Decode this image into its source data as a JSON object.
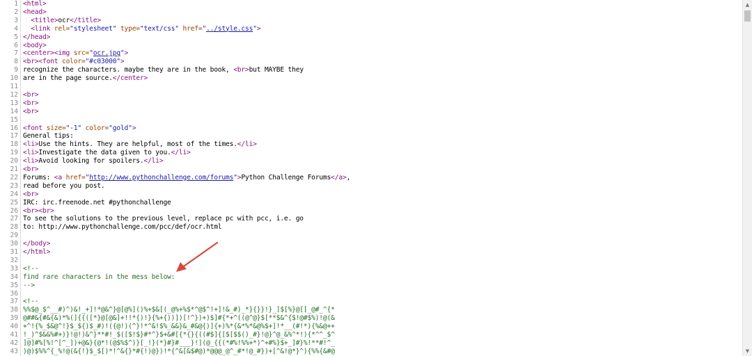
{
  "source_view": {
    "lines": [
      {
        "n": "1",
        "segs": [
          {
            "t": "<html>",
            "c": "tag"
          }
        ]
      },
      {
        "n": "2",
        "segs": [
          {
            "t": "<head>",
            "c": "tag"
          }
        ]
      },
      {
        "n": "3",
        "segs": [
          {
            "t": "  <title>",
            "c": "tag"
          },
          {
            "t": "ocr",
            "c": "text"
          },
          {
            "t": "</title>",
            "c": "tag"
          }
        ]
      },
      {
        "n": "4",
        "segs": [
          {
            "t": "  <link ",
            "c": "tag"
          },
          {
            "t": "rel=",
            "c": "attr"
          },
          {
            "t": "\"stylesheet\" ",
            "c": "val"
          },
          {
            "t": "type=",
            "c": "attr"
          },
          {
            "t": "\"text/css\" ",
            "c": "val"
          },
          {
            "t": "href=",
            "c": "attr"
          },
          {
            "t": "\"",
            "c": "val"
          },
          {
            "t": "../style.css",
            "c": "link"
          },
          {
            "t": "\"",
            "c": "val"
          },
          {
            "t": ">",
            "c": "tag"
          }
        ]
      },
      {
        "n": "5",
        "segs": [
          {
            "t": "</head>",
            "c": "tag"
          }
        ]
      },
      {
        "n": "6",
        "segs": [
          {
            "t": "<body>",
            "c": "tag"
          }
        ]
      },
      {
        "n": "7",
        "segs": [
          {
            "t": "<center><img ",
            "c": "tag"
          },
          {
            "t": "src=",
            "c": "attr"
          },
          {
            "t": "\"",
            "c": "val"
          },
          {
            "t": "ocr.jpg",
            "c": "link"
          },
          {
            "t": "\"",
            "c": "val"
          },
          {
            "t": ">",
            "c": "tag"
          }
        ]
      },
      {
        "n": "8",
        "segs": [
          {
            "t": "<br><font ",
            "c": "tag"
          },
          {
            "t": "color=",
            "c": "attr"
          },
          {
            "t": "\"#c03000\"",
            "c": "val"
          },
          {
            "t": ">",
            "c": "tag"
          }
        ]
      },
      {
        "n": "9",
        "segs": [
          {
            "t": "recognize the characters. maybe they are in the book, ",
            "c": "text"
          },
          {
            "t": "<br>",
            "c": "tag"
          },
          {
            "t": "but MAYBE they",
            "c": "text"
          }
        ]
      },
      {
        "n": "10",
        "segs": [
          {
            "t": "are in the page source.",
            "c": "text"
          },
          {
            "t": "</center>",
            "c": "tag"
          }
        ]
      },
      {
        "n": "11",
        "segs": []
      },
      {
        "n": "12",
        "segs": [
          {
            "t": "<br>",
            "c": "tag"
          }
        ]
      },
      {
        "n": "13",
        "segs": [
          {
            "t": "<br>",
            "c": "tag"
          }
        ]
      },
      {
        "n": "14",
        "segs": [
          {
            "t": "<br>",
            "c": "tag"
          }
        ]
      },
      {
        "n": "15",
        "segs": []
      },
      {
        "n": "16",
        "segs": [
          {
            "t": "<font ",
            "c": "tag"
          },
          {
            "t": "size=",
            "c": "attr"
          },
          {
            "t": "\"-1\" ",
            "c": "val"
          },
          {
            "t": "color=",
            "c": "attr"
          },
          {
            "t": "\"gold\"",
            "c": "val"
          },
          {
            "t": ">",
            "c": "tag"
          }
        ]
      },
      {
        "n": "17",
        "segs": [
          {
            "t": "General tips:",
            "c": "text"
          }
        ]
      },
      {
        "n": "18",
        "segs": [
          {
            "t": "<li>",
            "c": "tag"
          },
          {
            "t": "Use the hints. They are helpful, most of the times.",
            "c": "text"
          },
          {
            "t": "</li>",
            "c": "tag"
          }
        ]
      },
      {
        "n": "19",
        "segs": [
          {
            "t": "<li>",
            "c": "tag"
          },
          {
            "t": "Investigate the data given to you.",
            "c": "text"
          },
          {
            "t": "</li>",
            "c": "tag"
          }
        ]
      },
      {
        "n": "20",
        "segs": [
          {
            "t": "<li>",
            "c": "tag"
          },
          {
            "t": "Avoid looking for spoilers.",
            "c": "text"
          },
          {
            "t": "</li>",
            "c": "tag"
          }
        ]
      },
      {
        "n": "21",
        "segs": [
          {
            "t": "<br>",
            "c": "tag"
          }
        ]
      },
      {
        "n": "22",
        "segs": [
          {
            "t": "Forums: ",
            "c": "text"
          },
          {
            "t": "<a ",
            "c": "tag"
          },
          {
            "t": "href=",
            "c": "attr"
          },
          {
            "t": "\"",
            "c": "val"
          },
          {
            "t": "http://www.pythonchallenge.com/forums",
            "c": "link"
          },
          {
            "t": "\"",
            "c": "val"
          },
          {
            "t": ">",
            "c": "tag"
          },
          {
            "t": "Python Challenge Forums",
            "c": "text"
          },
          {
            "t": "</a>",
            "c": "tag"
          },
          {
            "t": ",",
            "c": "text"
          }
        ]
      },
      {
        "n": "23",
        "segs": [
          {
            "t": "read before you post.",
            "c": "text"
          }
        ]
      },
      {
        "n": "24",
        "segs": [
          {
            "t": "<br>",
            "c": "tag"
          }
        ]
      },
      {
        "n": "25",
        "segs": [
          {
            "t": "IRC: irc.freenode.net #pythonchallenge",
            "c": "text"
          }
        ]
      },
      {
        "n": "26",
        "segs": [
          {
            "t": "<br><br>",
            "c": "tag"
          }
        ]
      },
      {
        "n": "27",
        "segs": [
          {
            "t": "To see the solutions to the previous level, replace pc with pcc, i.e. go",
            "c": "text"
          }
        ]
      },
      {
        "n": "28",
        "segs": [
          {
            "t": "to: http://www.pythonchallenge.com/pcc/def/ocr.html",
            "c": "text"
          }
        ]
      },
      {
        "n": "29",
        "segs": []
      },
      {
        "n": "30",
        "segs": [
          {
            "t": "</body>",
            "c": "tag"
          }
        ]
      },
      {
        "n": "31",
        "segs": [
          {
            "t": "</html>",
            "c": "tag"
          }
        ]
      },
      {
        "n": "32",
        "segs": []
      },
      {
        "n": "33",
        "segs": [
          {
            "t": "<!--",
            "c": "comment"
          }
        ]
      },
      {
        "n": "34",
        "segs": [
          {
            "t": "find rare characters in the mess below:",
            "c": "comment"
          }
        ]
      },
      {
        "n": "35",
        "segs": [
          {
            "t": "-->",
            "c": "comment"
          }
        ]
      },
      {
        "n": "36",
        "segs": []
      },
      {
        "n": "37",
        "segs": [
          {
            "t": "<!--",
            "c": "comment"
          }
        ]
      },
      {
        "n": "38",
        "segs": [
          {
            "t": "%%$@_$^__#)^)&!_+]!*@&^}@[@%]()%+$&[(_@%+%$*^@$^!+]!&_#)_*}{}}!}_]$[%}@[[_@#_^{*",
            "c": "comment"
          }
        ]
      },
      {
        "n": "39",
        "segs": [
          {
            "t": "@##&{#&{&)*%(]{{([*}@[@&]+!!*{)!}{%+{))])[!^})+)$]#{*+^((@^@}$[**$&^{$!@#$%)!@(&",
            "c": "comment"
          }
        ]
      },
      {
        "n": "40",
        "segs": [
          {
            "t": "+^!{%_$&@^!}$_${)$_#)!({@!)(^}!*^&!$%_&&}&_#&@{)]{+)%*{&*%*&@%$+]!*__(#!*){%&@++",
            "c": "comment"
          }
        ]
      },
      {
        "n": "41",
        "segs": [
          {
            "t": "!_)^$&&%#+)}!@!)&^}**#!_$([$!$}#*^}$+&#[{*{}{((#$]{[$[$$()_#}!@}^@_&%^*!){*^^_$^",
            "c": "comment"
          }
        ]
      },
      {
        "n": "42",
        "segs": [
          {
            "t": "]@]#%[%!^[^_])+@&}{@*!(@$%$^)}[_!}(*}#}#___}!](@_{{(*#%!%%+*)^+#%}$+_]#}%!**#!^_",
            "c": "comment"
          }
        ]
      },
      {
        "n": "43",
        "segs": [
          {
            "t": ")@)$%%^{_%!@(&{!}$_$[)*!^&{}*#{!)@})!*{^&[&$#@)*@@@_@^_#*!@_#})+[^&!@*}^){%%{&#@",
            "c": "comment"
          }
        ]
      }
    ]
  }
}
